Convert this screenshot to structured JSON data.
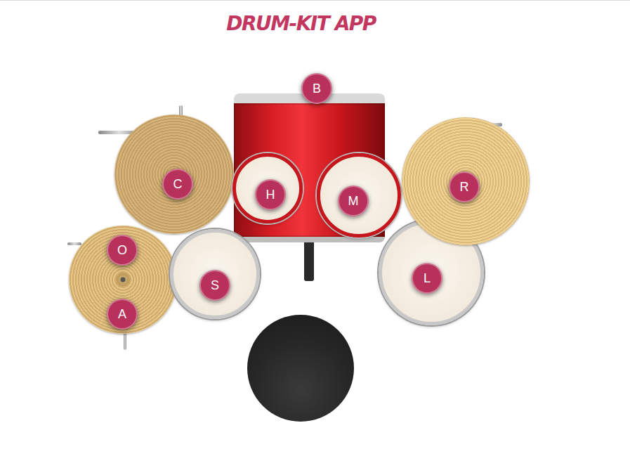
{
  "title": "DRUM-KIT APP",
  "pads": [
    {
      "label": "B"
    },
    {
      "label": "C"
    },
    {
      "label": "H"
    },
    {
      "label": "M"
    },
    {
      "label": "R"
    },
    {
      "label": "O"
    },
    {
      "label": "S"
    },
    {
      "label": "A"
    },
    {
      "label": "L"
    }
  ]
}
